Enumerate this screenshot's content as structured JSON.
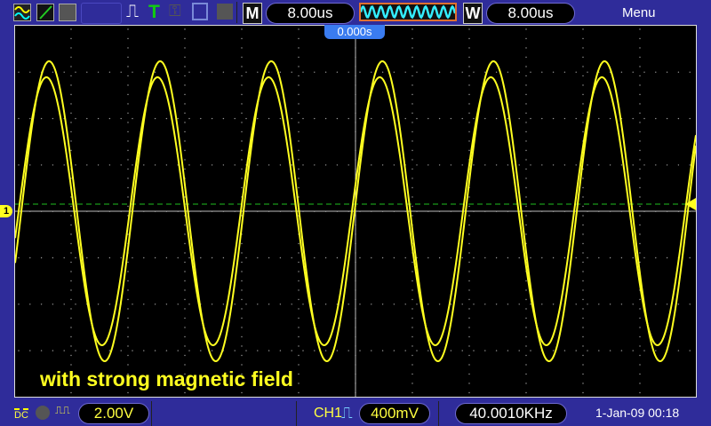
{
  "toolbar": {
    "timebase_mode": "M",
    "timebase": "8.00us",
    "window_mode": "W",
    "window_timebase": "8.00us",
    "menu": "Menu",
    "run_state_icon": "trigger-T-icon"
  },
  "screen": {
    "trigger_position": "0.000s",
    "channel_marker": "1",
    "annotation": "with strong magnetic field"
  },
  "status": {
    "coupling": "DC",
    "ch1_scale": "2.00V",
    "trigger_source": "CH1",
    "trigger_level": "400mV",
    "frequency": "40.0010KHz",
    "datetime": "1-Jan-09 00:18"
  },
  "colors": {
    "trace": "#ffff20",
    "grid": "#9a9a9a",
    "trigger_line": "#20c020",
    "background": "#2f2c9a"
  }
}
